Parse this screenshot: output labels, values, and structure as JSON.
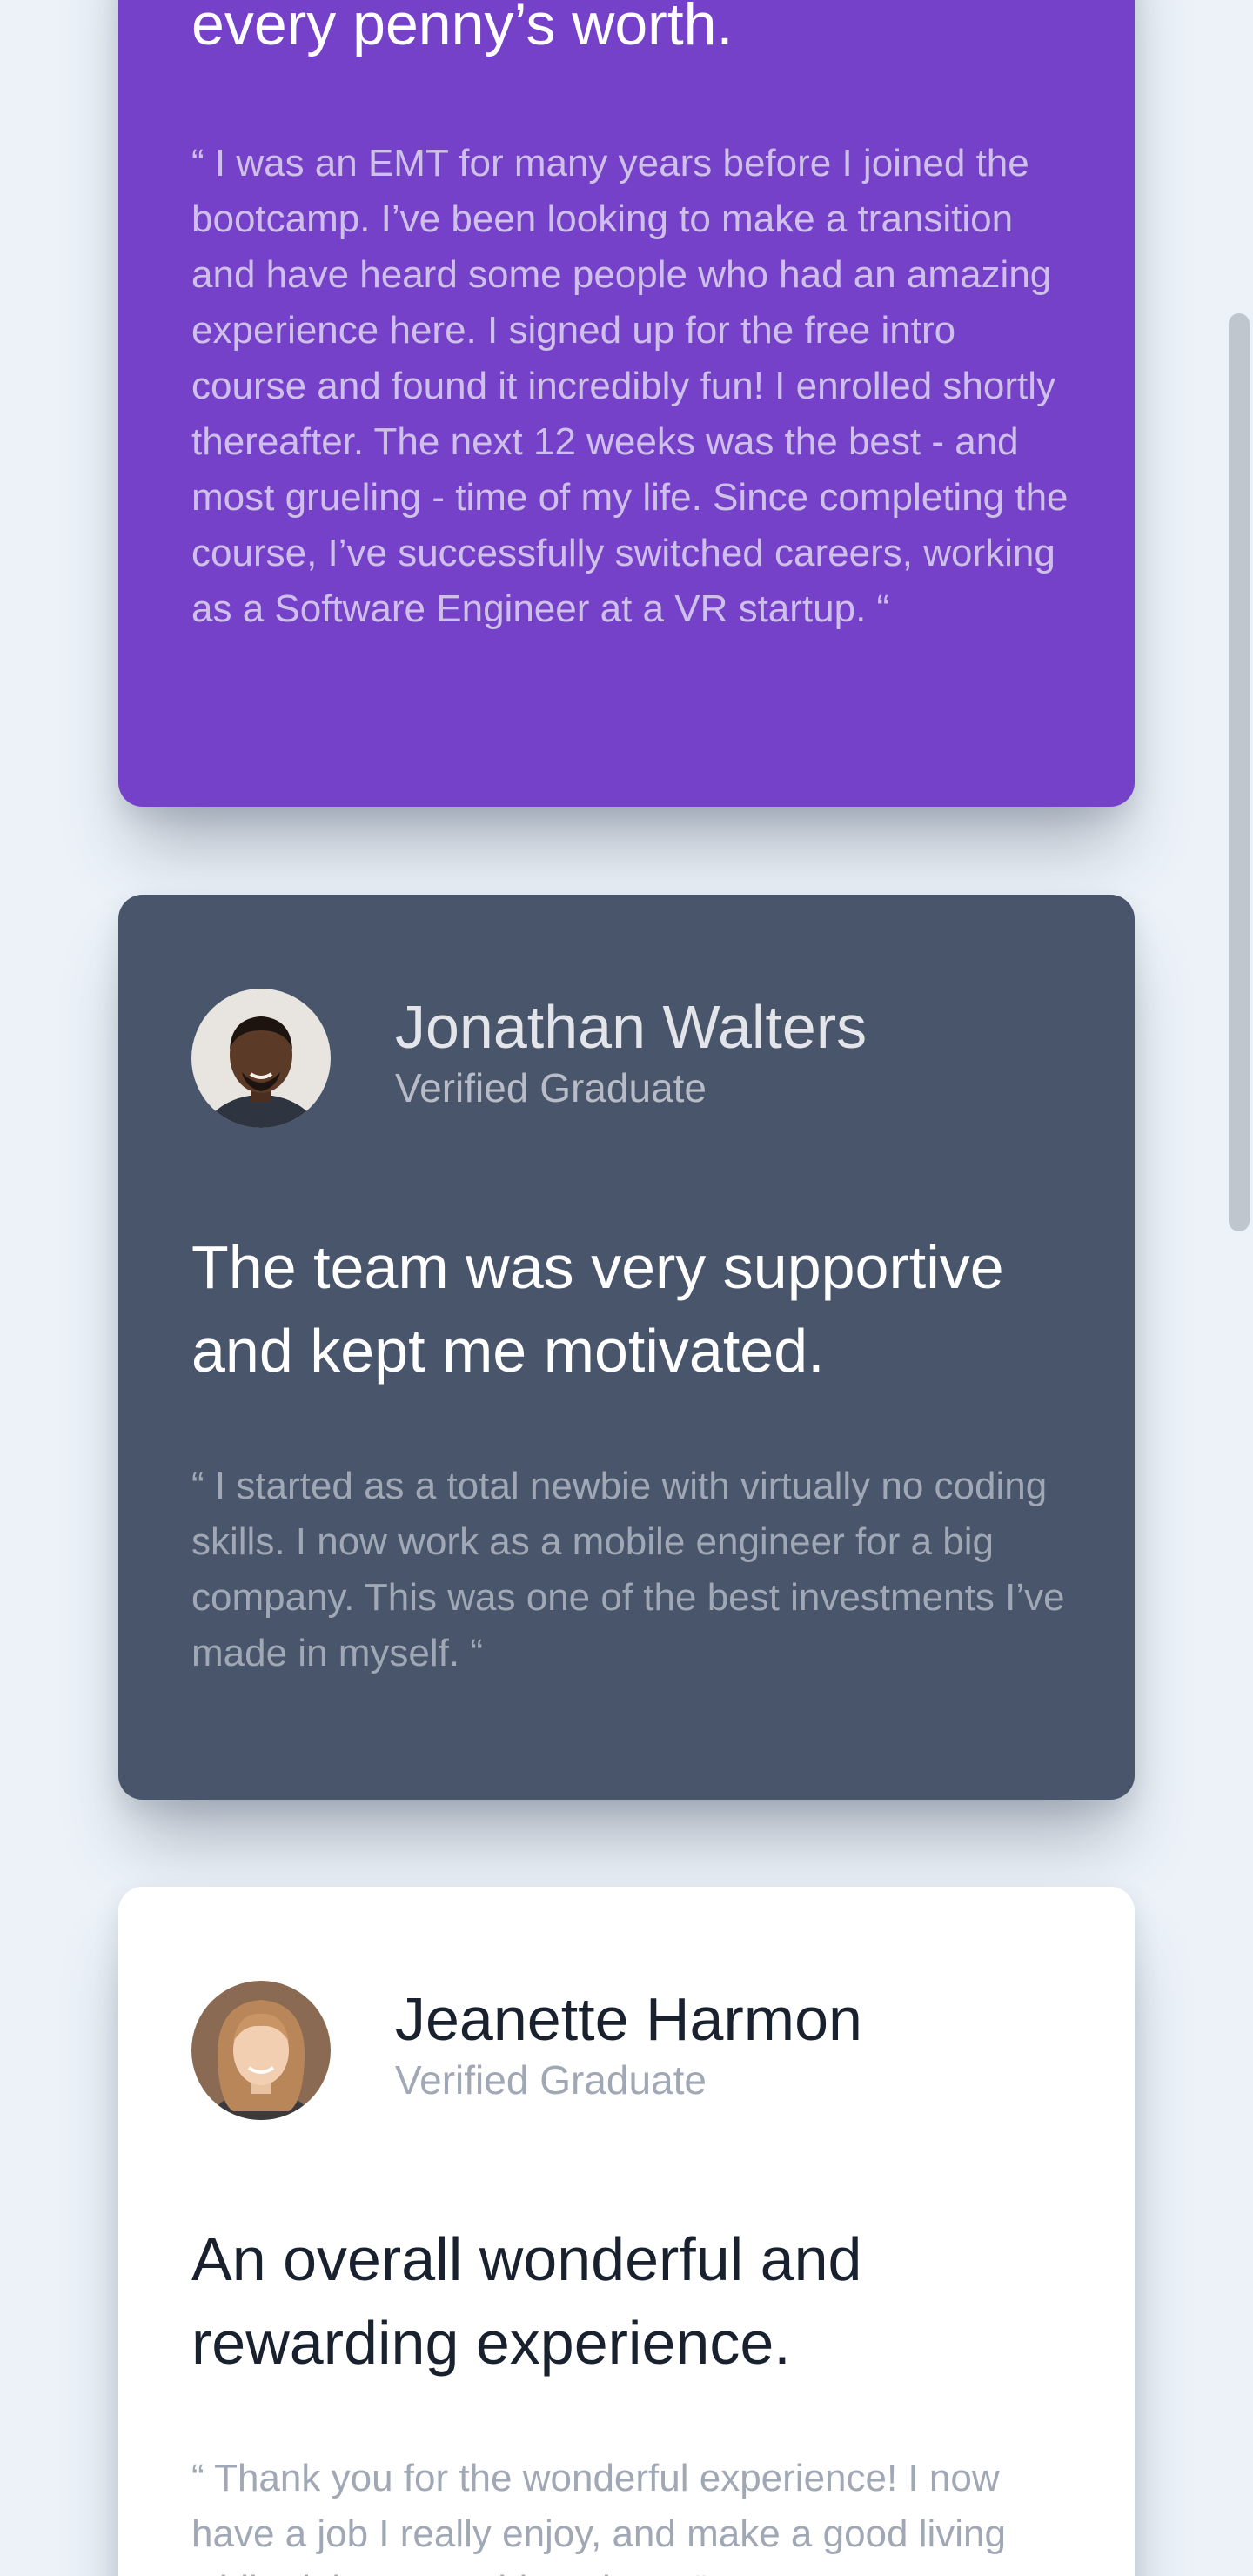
{
  "testimonials": [
    {
      "headline": "every penny’s worth.",
      "quote": "“ I was an EMT for many years before I joined the bootcamp. I’ve been looking to make a transition and have heard some people who had an amazing experience here. I signed up for the free intro course and found it incredibly fun! I enrolled shortly thereafter. The next 12 weeks was the best - and most grueling - time of my life. Since completing the course, I’ve successfully switched careers, working as a Software Engineer at a VR startup. “",
      "background": "#7541c8"
    },
    {
      "name": "Jonathan Walters",
      "role": "Verified Graduate",
      "headline": "The team was very supportive and kept me motivated.",
      "quote": "“ I started as a total newbie with virtually no coding skills. I now work as a mobile engineer for a big company. This was one of the best investments I’ve made in myself. “",
      "background": "#48556a",
      "avatar_icon": "user-avatar"
    },
    {
      "name": "Jeanette Harmon",
      "role": "Verified Graduate",
      "headline": "An overall wonderful and rewarding experience.",
      "quote": "“ Thank you for the wonderful experience! I now have a job I really enjoy, and make a good living while doing something I love. “",
      "background": "#ffffff",
      "avatar_icon": "user-avatar"
    }
  ],
  "colors": {
    "page_background": "#ecf2f8",
    "dark_text": "#19212e",
    "muted_text": "#a1a8b5"
  }
}
